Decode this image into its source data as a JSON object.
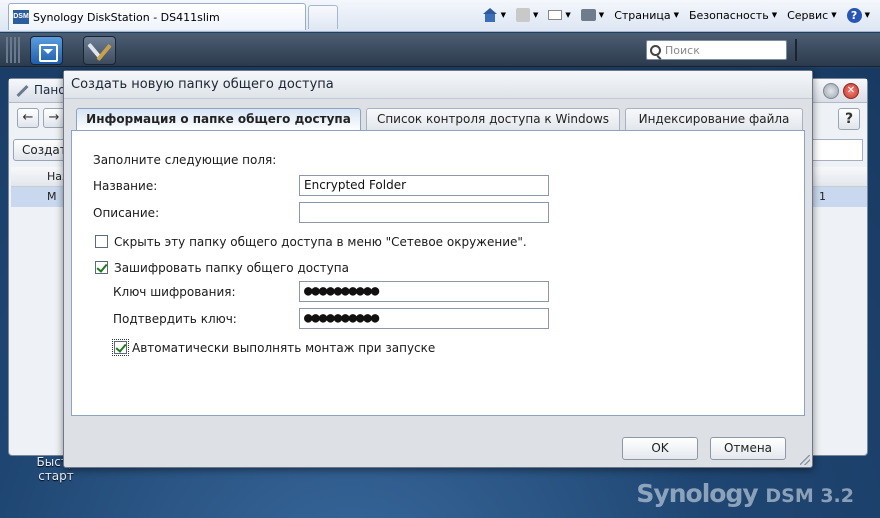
{
  "browser": {
    "tab_title": "Synology DiskStation - DS411slim",
    "tab_icon_text": "DSM",
    "commands": [
      {
        "label": "Страница"
      },
      {
        "label": "Безопасность"
      },
      {
        "label": "Сервис"
      }
    ]
  },
  "dsm": {
    "search_placeholder": "Поиск"
  },
  "background_window": {
    "title": "Пано",
    "create_button": "Создат",
    "column_name": "Наз",
    "row_name": "М",
    "row_value": "1",
    "help": "?"
  },
  "desktop": {
    "shortcut_label": "Быстр старт",
    "logo": "Synology",
    "logo_version": "DSM 3.2"
  },
  "dialog": {
    "title": "Создать новую папку общего доступа",
    "tabs": [
      {
        "label": "Информация о папке общего доступа",
        "active": true
      },
      {
        "label": "Список контроля доступа к Windows",
        "active": false
      },
      {
        "label": "Индексирование файла",
        "active": false
      }
    ],
    "intro": "Заполните следующие поля:",
    "name_label": "Название:",
    "name_value": "Encrypted Folder",
    "description_label": "Описание:",
    "description_value": "",
    "hide_label": "Скрыть эту папку общего доступа в меню \"Сетевое окружение\".",
    "hide_checked": false,
    "encrypt_label": "Зашифровать папку общего доступа",
    "encrypt_checked": true,
    "key_label": "Ключ шифрования:",
    "key_value": "●●●●●●●●●●",
    "confirm_label": "Подтвердить ключ:",
    "confirm_value": "●●●●●●●●●●",
    "automount_label": "Автоматически выполнять монтаж при запуске",
    "automount_checked": true,
    "ok_label": "OK",
    "cancel_label": "Отмена"
  }
}
